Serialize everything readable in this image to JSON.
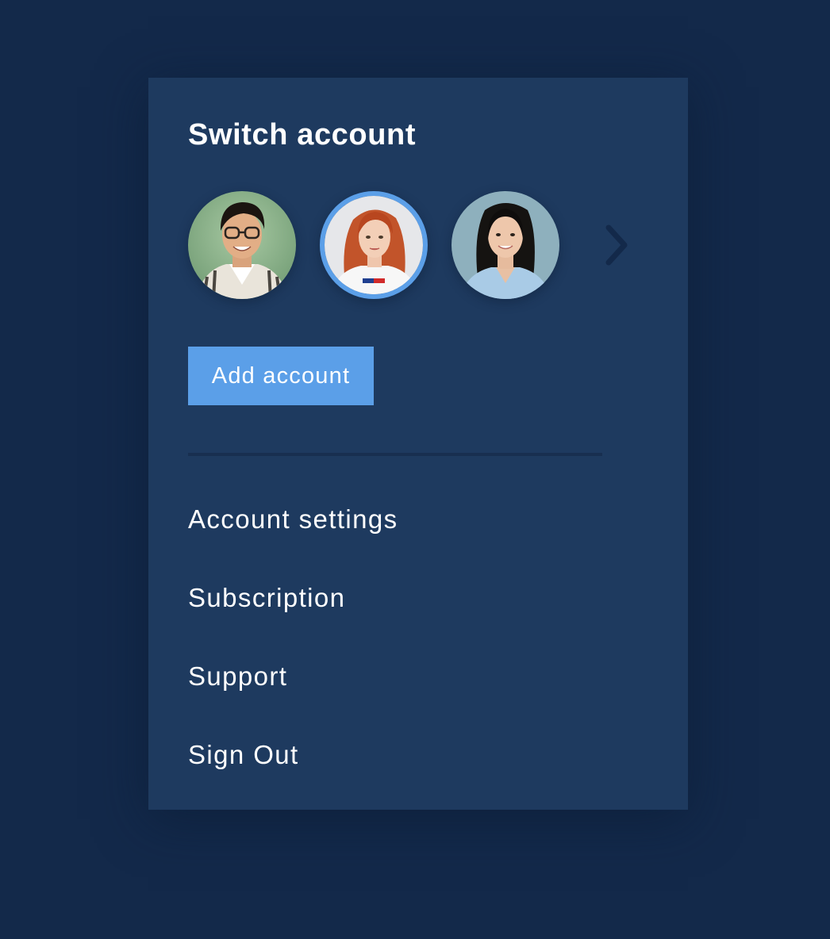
{
  "panel": {
    "title": "Switch account"
  },
  "accounts": [
    {
      "avatar": "avatar-man-glasses",
      "selected": false
    },
    {
      "avatar": "avatar-woman-red-hair",
      "selected": true
    },
    {
      "avatar": "avatar-woman-dark-hair",
      "selected": false
    }
  ],
  "carousel": {
    "next_icon": "chevron-right-icon"
  },
  "add_account": {
    "label": "Add account"
  },
  "menu": {
    "items": [
      {
        "label": "Account settings"
      },
      {
        "label": "Subscription"
      },
      {
        "label": "Support"
      },
      {
        "label": "Sign Out"
      }
    ]
  },
  "colors": {
    "page_background": "#13294a",
    "panel_background": "#1e3a5f",
    "accent": "#5b9fe8",
    "divider": "#182f50",
    "text": "#ffffff"
  }
}
